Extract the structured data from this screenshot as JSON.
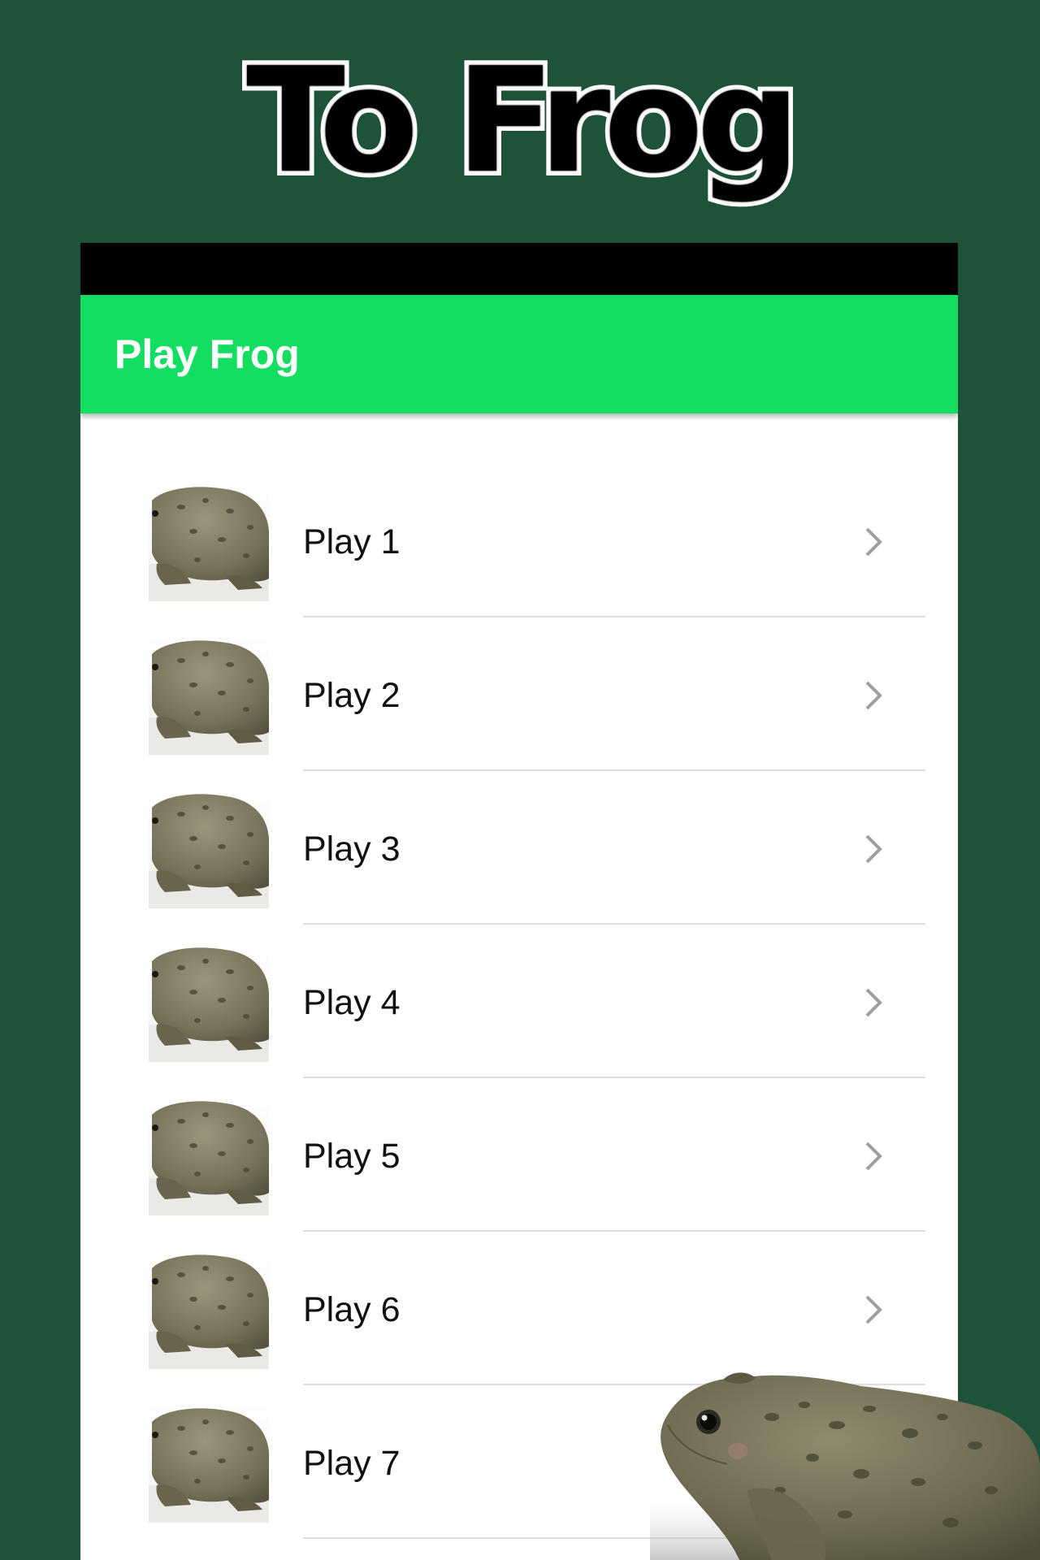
{
  "promo": {
    "title": "To Frog"
  },
  "app_bar": {
    "title": "Play Frog",
    "color": "#13de62"
  },
  "list": {
    "items": [
      {
        "label": "Play 1",
        "thumbnail": "frog-thumbnail",
        "action_icon": "chevron-right-icon"
      },
      {
        "label": "Play 2",
        "thumbnail": "frog-thumbnail",
        "action_icon": "chevron-right-icon"
      },
      {
        "label": "Play 3",
        "thumbnail": "frog-thumbnail",
        "action_icon": "chevron-right-icon"
      },
      {
        "label": "Play 4",
        "thumbnail": "frog-thumbnail",
        "action_icon": "chevron-right-icon"
      },
      {
        "label": "Play 5",
        "thumbnail": "frog-thumbnail",
        "action_icon": "chevron-right-icon"
      },
      {
        "label": "Play 6",
        "thumbnail": "frog-thumbnail",
        "action_icon": "chevron-right-icon"
      },
      {
        "label": "Play 7",
        "thumbnail": "frog-thumbnail",
        "action_icon": "chevron-right-icon"
      }
    ]
  },
  "colors": {
    "background": "#1e533a",
    "accent": "#13de62",
    "status_bar": "#000000"
  }
}
